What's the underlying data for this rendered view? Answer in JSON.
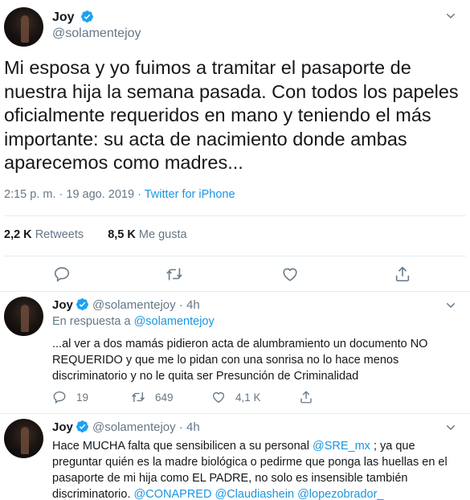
{
  "main_tweet": {
    "name": "Joy",
    "handle": "@solamentejoy",
    "text": "Mi esposa y yo fuimos a tramitar el pasaporte de nuestra hija la semana pasada. Con todos los papeles oficialmente requeridos en mano y teniendo el más importante: su acta de nacimiento donde ambas aparecemos como madres...",
    "time": "2:15 p. m.",
    "dot": "·",
    "date": "19 ago. 2019",
    "source": "Twitter for iPhone",
    "retweets_count": "2,2 K",
    "retweets_label": "Retweets",
    "likes_count": "8,5 K",
    "likes_label": "Me gusta",
    "icons": [
      "reply-icon",
      "retweet-icon",
      "like-icon",
      "share-icon"
    ]
  },
  "replies": [
    {
      "name": "Joy",
      "handle": "@solamentejoy",
      "dot": "·",
      "time": "4h",
      "in_reply_prefix": "En respuesta a",
      "in_reply_handle": "@solamentejoy",
      "text": "...al ver a dos mamás pidieron acta de alumbramiento un documento NO REQUERIDO y que me lo pidan con una sonrisa no lo hace menos discriminatorio y no le quita ser Presunción de Criminalidad",
      "reply_count": "19",
      "retweet_count": "649",
      "like_count": "4,1 K"
    },
    {
      "name": "Joy",
      "handle": "@solamentejoy",
      "dot": "·",
      "time": "4h",
      "text_1": "Hace MUCHA falta que sensibilicen a su personal ",
      "mention_1": "@SRE_mx",
      "text_2": " ; ya que preguntar quién es la madre biológica o pedirme que ponga las huellas en el pasaporte de mi hija como EL PADRE, no solo es insensible también discriminatorio. ",
      "mention_2": "@CONAPRED",
      "mention_3": "@Claudiashein",
      "mention_4": "@lopezobrador_"
    }
  ],
  "colors": {
    "accent": "#1b95e0",
    "secondary": "#657786",
    "text": "#14171a",
    "border": "#e6ecf0"
  }
}
